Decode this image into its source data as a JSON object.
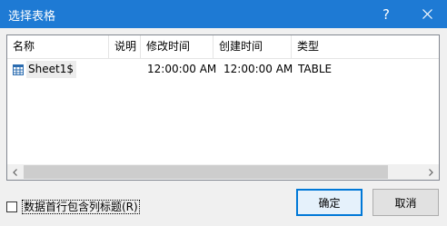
{
  "window": {
    "title": "选择表格",
    "help_label": "?"
  },
  "list": {
    "columns": [
      "名称",
      "说明",
      "修改时间",
      "创建时间",
      "类型"
    ],
    "rows": [
      {
        "name": "Sheet1$",
        "description": "",
        "modified": "12:00:00 AM",
        "created": "12:00:00 AM",
        "type": "TABLE"
      }
    ]
  },
  "scrollbar": {
    "left_arrow": "<",
    "right_arrow": ">"
  },
  "options": {
    "header_checkbox_label": "数据首行包含列标题(R)",
    "header_checked": false
  },
  "buttons": {
    "ok": "确定",
    "cancel": "取消"
  },
  "colors": {
    "title_bar": "#1e7ad4",
    "accent": "#0078d7",
    "icon": "#2b6cb0"
  }
}
